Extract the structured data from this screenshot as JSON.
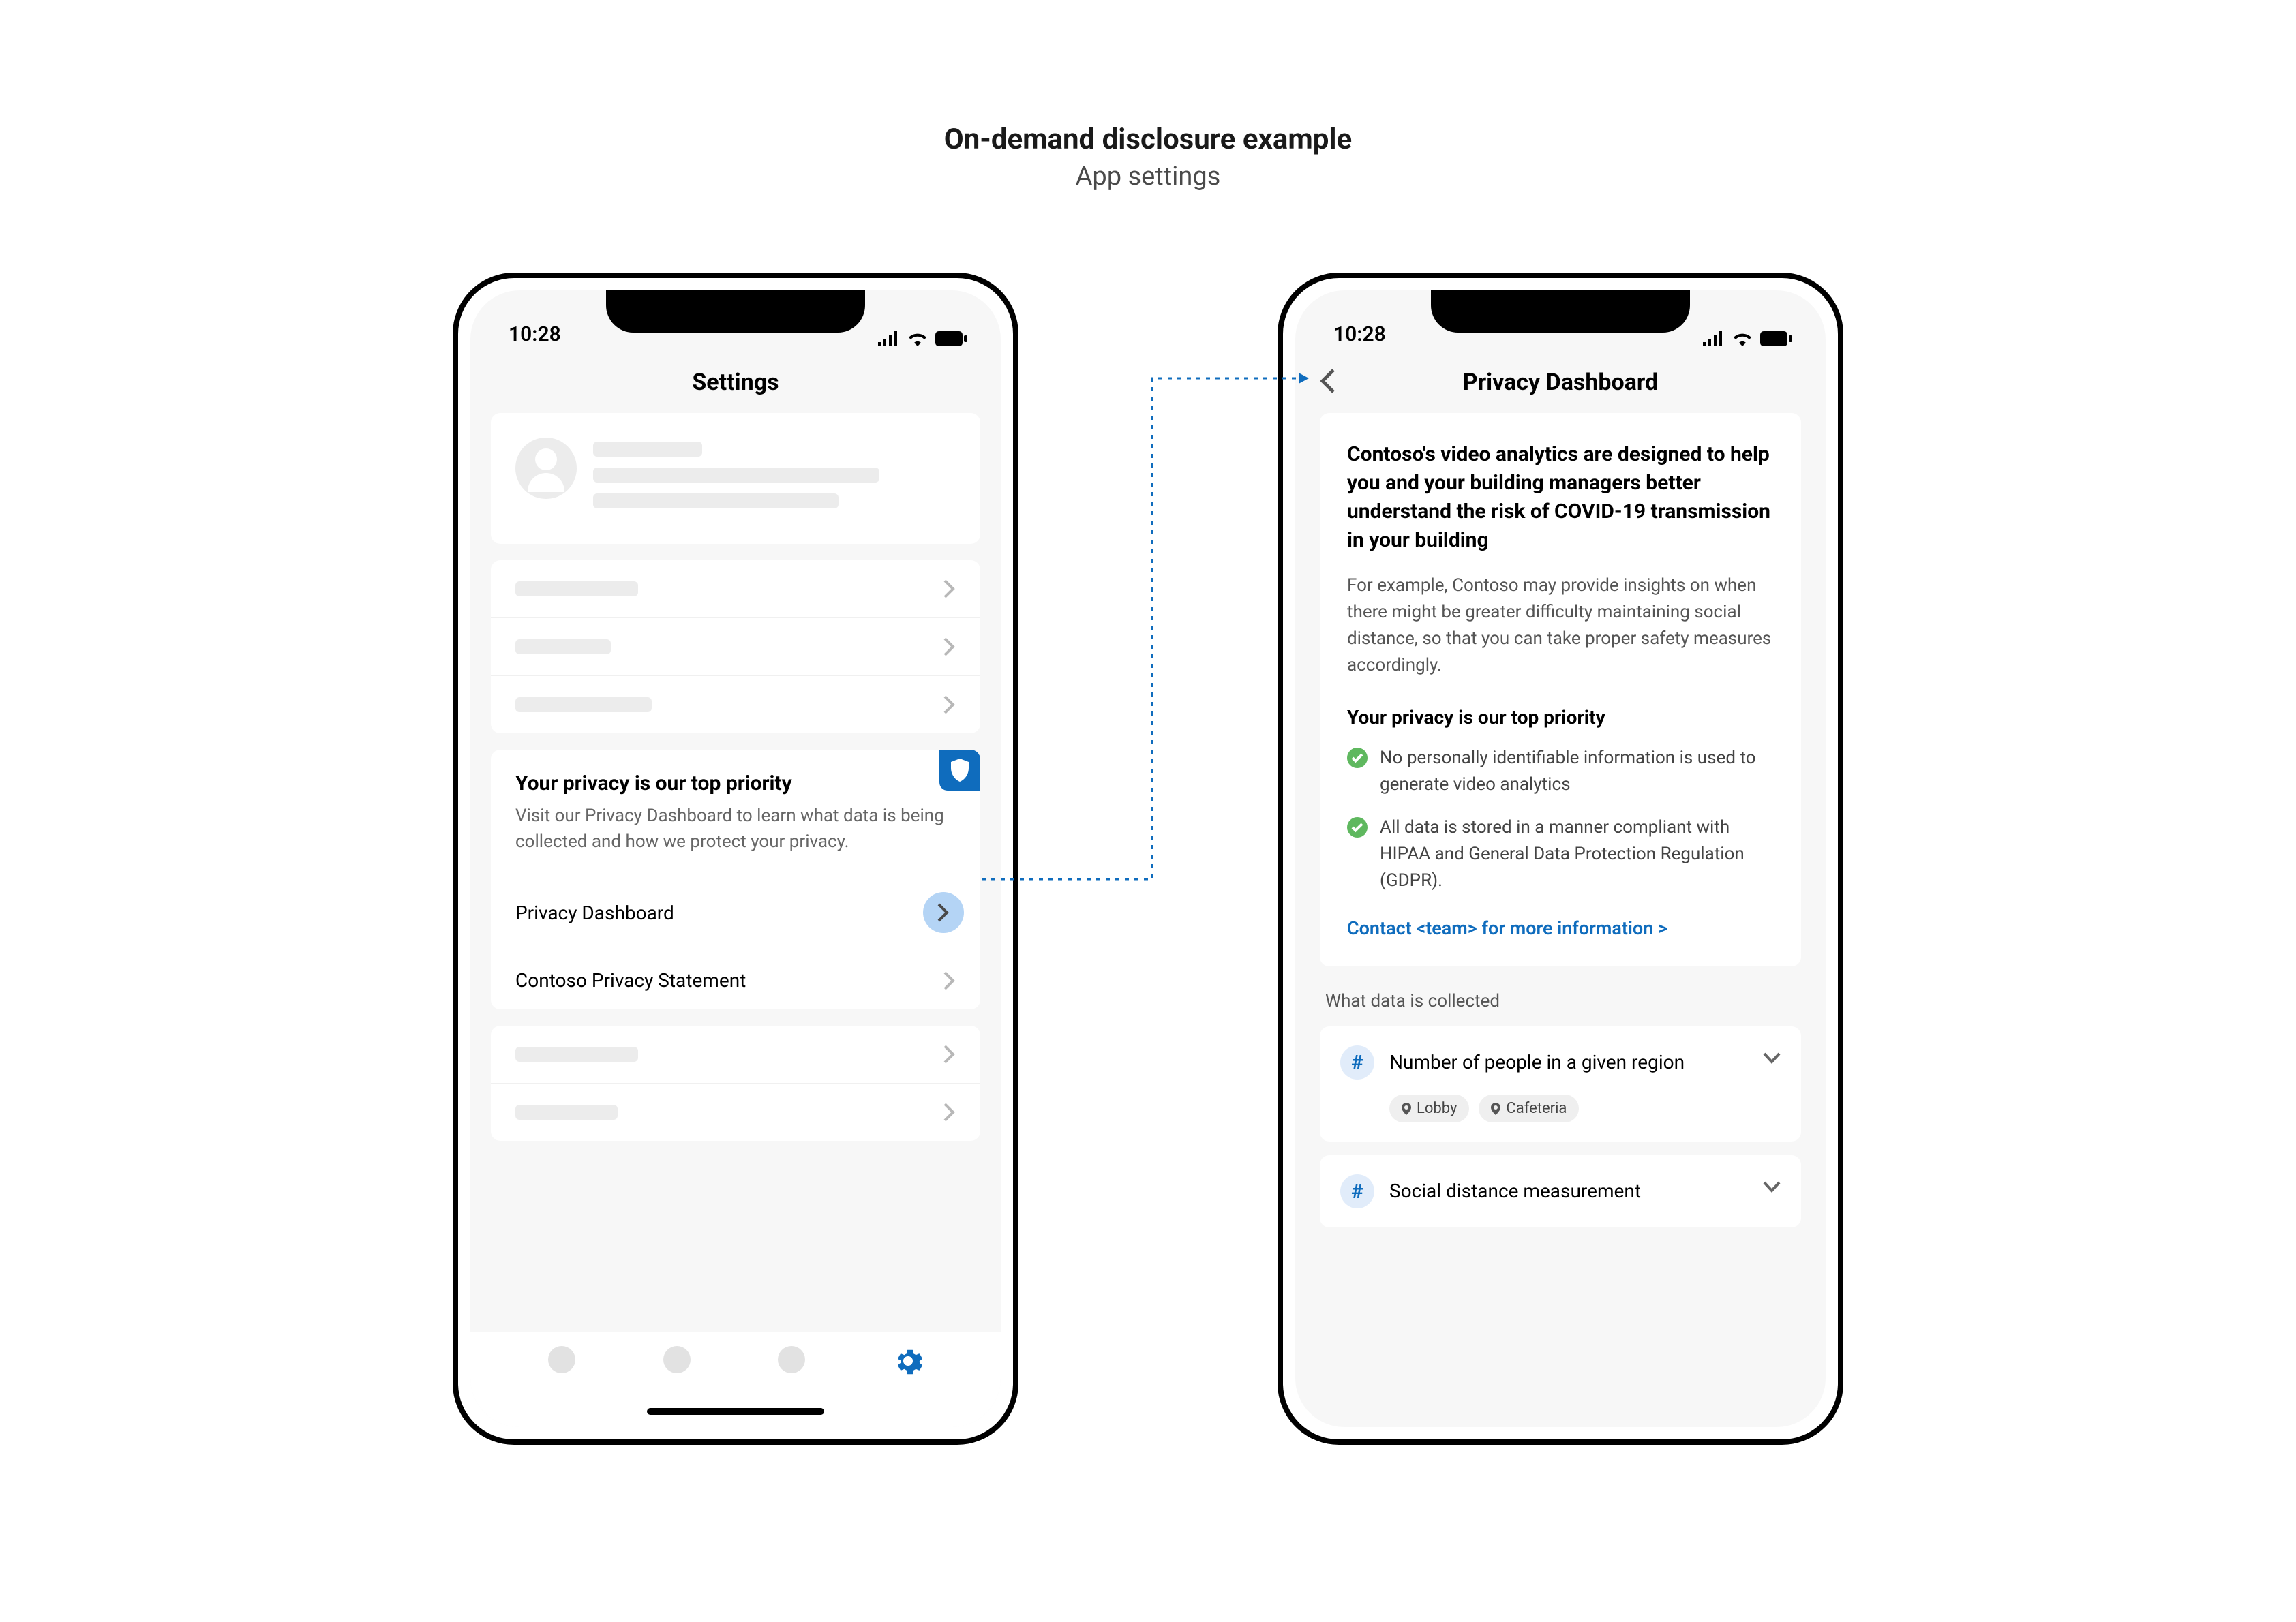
{
  "page": {
    "title": "On-demand disclosure example",
    "subtitle": "App settings"
  },
  "status": {
    "time": "10:28"
  },
  "left_phone": {
    "nav_title": "Settings",
    "privacy_card": {
      "title": "Your privacy is our top priority",
      "description": "Visit our Privacy Dashboard to learn what data is being collected and how we protect your privacy.",
      "link1": "Privacy Dashboard",
      "link2": "Contoso Privacy Statement"
    }
  },
  "right_phone": {
    "nav_title": "Privacy Dashboard",
    "intro_heading": "Contoso's video analytics are designed to help you and your building managers better understand the risk of COVID-19 transmission in your building",
    "intro_body": "For example, Contoso may provide insights on when there might be greater difficulty maintaining social distance, so that you can take proper safety measures accordingly.",
    "subheading": "Your privacy is our top priority",
    "bullets": [
      "No personally identifiable information is used to generate video analytics",
      "All data is stored in a manner compliant with HIPAA and General Data Protection Regulation (GDPR)."
    ],
    "contact_link": "Contact <team> for more information >",
    "section_label": "What data is collected",
    "data_items": [
      {
        "title": "Number of people in a given region",
        "chips": [
          "Lobby",
          "Cafeteria"
        ]
      },
      {
        "title": "Social distance measurement",
        "chips": []
      }
    ]
  },
  "colors": {
    "accent": "#0f6cbd",
    "success": "#5fb85f"
  }
}
